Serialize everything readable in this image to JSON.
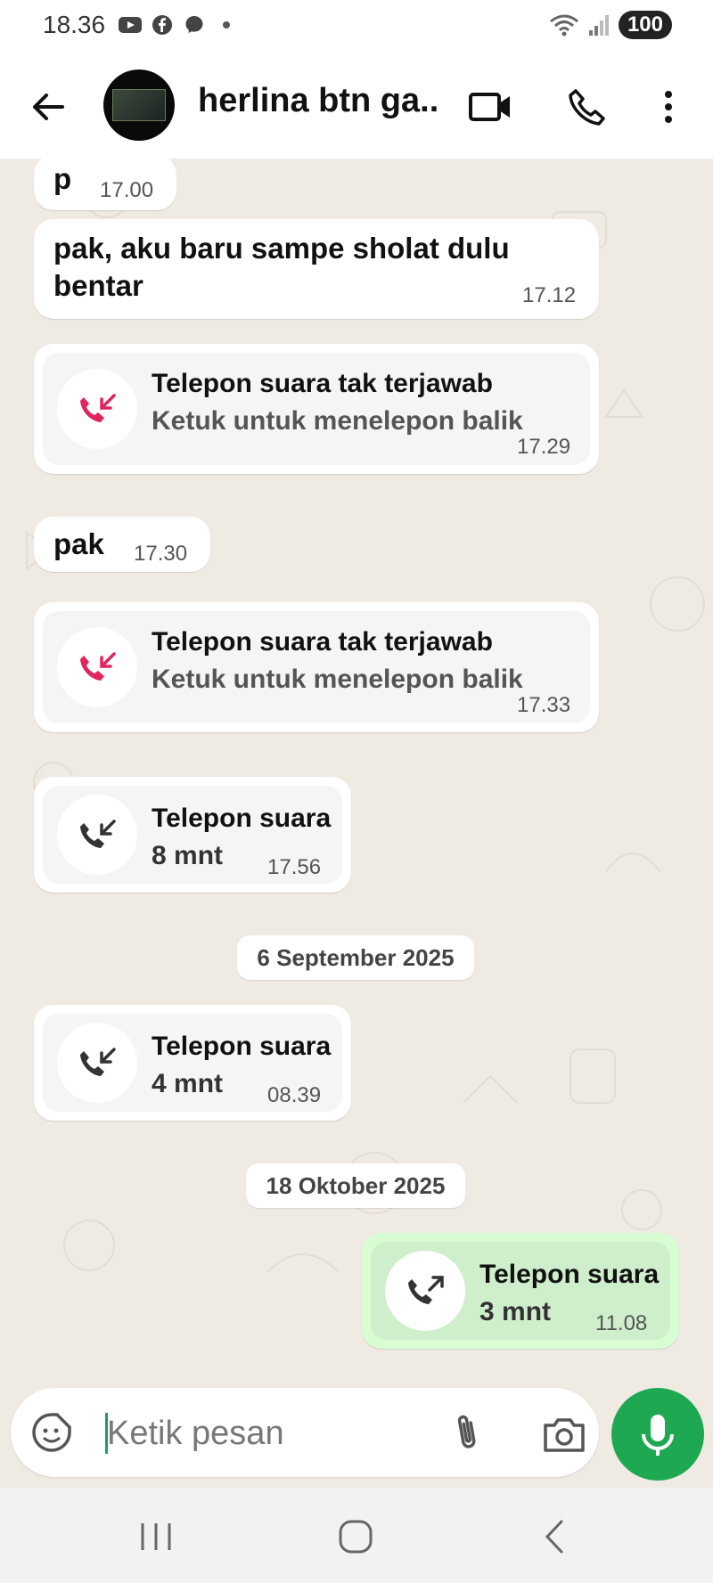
{
  "status_bar": {
    "time": "18.36",
    "battery": "100"
  },
  "header": {
    "contact_name": "herlina btn ga..."
  },
  "messages": [
    {
      "text": "p",
      "time": "17.00"
    },
    {
      "text_line1": "pak, aku baru sampe  sholat dulu",
      "text_line2": "bentar",
      "time": "17.12"
    },
    {
      "title": "Telepon suara tak terjawab",
      "subtitle": "Ketuk untuk menelepon balik",
      "time": "17.29"
    },
    {
      "text": "pak",
      "time": "17.30"
    },
    {
      "title": "Telepon suara tak terjawab",
      "subtitle": "Ketuk untuk menelepon balik",
      "time": "17.33"
    },
    {
      "title": "Telepon suara",
      "subtitle": "8 mnt",
      "time": "17.56"
    },
    {
      "date": "6 September 2025"
    },
    {
      "title": "Telepon suara",
      "subtitle": "4 mnt",
      "time": "08.39"
    },
    {
      "date": "18 Oktober 2025"
    },
    {
      "title": "Telepon suara",
      "subtitle": "3 mnt",
      "time": "11.08"
    }
  ],
  "input": {
    "placeholder": "Ketik pesan"
  },
  "colors": {
    "accent_green": "#1da851",
    "missed_call_red": "#e0245e",
    "chat_background": "#efeae2",
    "outgoing_bubble": "#d9fdd3"
  },
  "icons": {
    "status": [
      "youtube-icon",
      "facebook-icon",
      "messenger-icon",
      "wifi-icon",
      "signal-icon"
    ],
    "header": [
      "back-arrow-icon",
      "video-call-icon",
      "phone-icon",
      "more-options-icon"
    ],
    "input": [
      "sticker-icon",
      "attach-icon",
      "camera-icon",
      "mic-icon"
    ],
    "nav": [
      "recents-icon",
      "home-icon",
      "back-icon"
    ]
  }
}
